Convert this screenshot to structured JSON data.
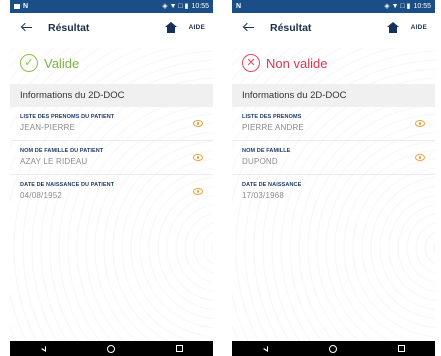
{
  "screens": [
    {
      "statusbar": {
        "icons_right": "◈ ▼ □ ▮",
        "time": "10:55",
        "left_text": "N"
      },
      "appbar": {
        "title": "Résultat",
        "aide_label": "AIDE"
      },
      "status": {
        "label": "Valide",
        "state": "ok",
        "symbol": "✓",
        "color": "#7cb342"
      },
      "section_title": "Informations du 2D-DOC",
      "fields": [
        {
          "label": "LISTE DES PRENOMS DU PATIENT",
          "value": "JEAN-PIERRE",
          "has_eye": true
        },
        {
          "label": "NOM DE FAMILLE DU PATIENT",
          "value": "AZAY LE RIDEAU",
          "has_eye": true
        },
        {
          "label": "DATE DE NAISSANCE DU PATIENT",
          "value": "04/08/1952",
          "has_eye": true
        }
      ]
    },
    {
      "statusbar": {
        "icons_right": "◈ ▼ □ ▮",
        "time": "10:55",
        "left_text": "N"
      },
      "appbar": {
        "title": "Résultat",
        "aide_label": "AIDE"
      },
      "status": {
        "label": "Non valide",
        "state": "ko",
        "symbol": "✕",
        "color": "#dd3650"
      },
      "section_title": "Informations du 2D-DOC",
      "fields": [
        {
          "label": "LISTE DES PRENOMS",
          "value": "PIERRE ANDRE",
          "has_eye": true
        },
        {
          "label": "NOM DE FAMILLE",
          "value": "DUPOND",
          "has_eye": true
        },
        {
          "label": "DATE DE NAISSANCE",
          "value": "17/03/1968",
          "has_eye": false
        }
      ]
    }
  ],
  "colors": {
    "statusbar": "#1a4e86",
    "accent_navy": "#1d3b66",
    "eye": "#e6a23c"
  },
  "icons": [
    "back-arrow-icon",
    "home-icon",
    "check-circle-icon",
    "x-circle-icon",
    "eye-icon",
    "nav-back-icon",
    "nav-home-icon",
    "nav-recent-icon"
  ]
}
